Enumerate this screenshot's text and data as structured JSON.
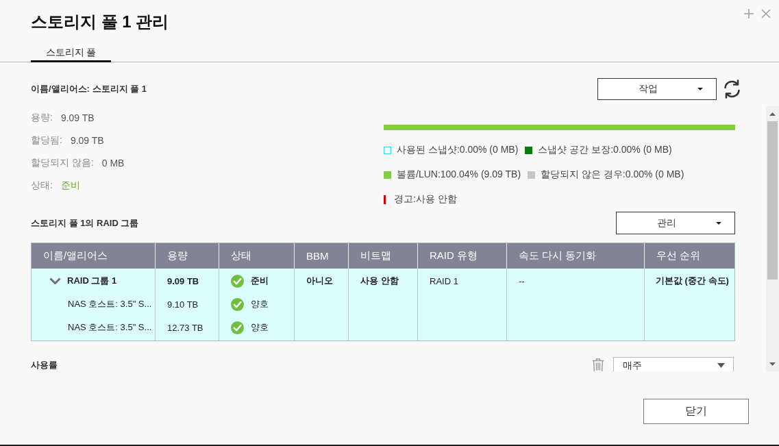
{
  "window": {
    "title": "스토리지 풀 1 관리"
  },
  "tabs": [
    {
      "label": "스토리지 풀",
      "selected": true
    }
  ],
  "pool": {
    "name": "이름/앨리어스: 스토리지 풀 1",
    "actions_menu": {
      "label": "작업"
    }
  },
  "summary": [
    {
      "label": "용량:",
      "value": "9.09 TB",
      "kind": "plain"
    },
    {
      "label": "할당됨:",
      "value": "9.09 TB",
      "kind": "plain"
    },
    {
      "label": "할당되지 않음:",
      "value": "0 MB",
      "kind": "plain"
    },
    {
      "label": "상태:",
      "value": "준비",
      "kind": "status"
    }
  ],
  "usage": {
    "level": 1,
    "legend": [
      [
        {
          "label": "사용된 스냅샷:0.00% (0 MB)",
          "color": "#38d4e2",
          "kind": "outline"
        },
        {
          "label": "스냅샷 공간 보장:0.00% (0 MB)",
          "color": "#0b7d0b",
          "kind": "solid"
        }
      ],
      [
        {
          "label": "볼륨/LUN:100.04% (9.09 TB)",
          "color": "#84cc46",
          "kind": "solid"
        },
        {
          "label": "할당되지 않은 경우:0.00% (0 MB)",
          "color": "#c6c6c6",
          "kind": "solid"
        }
      ],
      [
        {
          "label": "경고:사용 안함",
          "color": "#d20000",
          "kind": "line"
        }
      ]
    ]
  },
  "raid_groups": {
    "title": "스토리지 풀 1의 RAID 그룹",
    "manage_menu": {
      "label": "관리"
    },
    "columns": [
      "이름/앨리어스",
      "용량",
      "상태",
      "BBM",
      "비트맵",
      "RAID 유형",
      "속도 다시 동기화",
      "우선 순위"
    ],
    "rows": [
      {
        "name": "RAID 그룹 1",
        "capacity": "9.09 TB",
        "status": "준비",
        "healthy": true,
        "bbm": "아니오",
        "bitmap": "사용 안함",
        "raid_type": "RAID 1",
        "resync_speed": "--",
        "priority": "기본값 (중간 속도)",
        "expanded": true,
        "selected": true,
        "children": [
          {
            "name": "NAS 호스트: 3.5\" S...",
            "capacity": "9.10 TB",
            "status": "양호",
            "healthy": true
          },
          {
            "name": "NAS 호스트: 3.5\" S...",
            "capacity": "12.73 TB",
            "status": "양호",
            "healthy": true
          }
        ]
      }
    ]
  },
  "usage_history": {
    "title": "사용률",
    "period": {
      "value": "매주"
    }
  },
  "footer": {
    "close_button": "닫기"
  }
}
